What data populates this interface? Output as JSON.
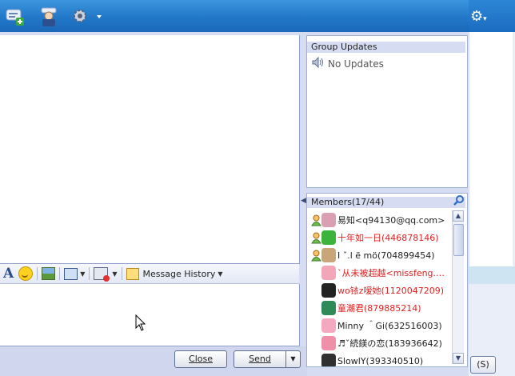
{
  "group_updates": {
    "title": "Group Updates",
    "empty_text": "No Updates"
  },
  "members": {
    "title": "Members(17/44)",
    "list": [
      {
        "name": "易知",
        "id": "<q94130@qq.com>",
        "color": "#222222",
        "status_icon": "person-icon",
        "avatar_color": "#d9a0b4"
      },
      {
        "name": "十年如一日",
        "id": "(446878146)",
        "color": "#e02020",
        "status_icon": "person-icon",
        "avatar_color": "#3cb43c"
      },
      {
        "name": "I ˇ.l ë mö",
        "id": "(704899454)",
        "color": "#222222",
        "status_icon": "person-icon",
        "avatar_color": "#c9a57a"
      },
      {
        "name": "ˋ从未被超越",
        "id": "<missfeng.…",
        "color": "#e02020",
        "status_icon": "",
        "avatar_color": "#f3a6b8"
      },
      {
        "name": "wo铱z嗳她",
        "id": "(1120047209)",
        "color": "#e02020",
        "status_icon": "",
        "avatar_color": "#222222"
      },
      {
        "name": "童潮君",
        "id": "(879885214)",
        "color": "#e02020",
        "status_icon": "",
        "avatar_color": "#2e8b57"
      },
      {
        "name": "Minny ＾Gi",
        "id": "(632516003)",
        "color": "#222222",
        "status_icon": "",
        "avatar_color": "#f5a9c0"
      },
      {
        "name": "♬ˇ続鎂の恋",
        "id": "(183936642)",
        "color": "#222222",
        "status_icon": "",
        "avatar_color": "#f08fa8"
      },
      {
        "name": "SlowlY",
        "id": "(393340510)",
        "color": "#222222",
        "status_icon": "",
        "avatar_color": "#303030"
      }
    ]
  },
  "toolbar": {
    "message_history": "Message History"
  },
  "buttons": {
    "close_label": "Close",
    "close_key": "C",
    "send_label": "Send",
    "send_key": "S",
    "bg_btn_label": "(S)"
  },
  "colors": {
    "titlebar": "#2278c8",
    "panel_header": "#d6dcf2"
  }
}
